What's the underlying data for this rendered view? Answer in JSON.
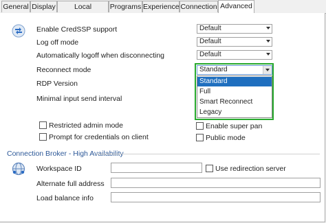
{
  "tabs": [
    {
      "label": "General",
      "active": false
    },
    {
      "label": "Display",
      "active": false
    },
    {
      "label": "Local Resources",
      "active": false
    },
    {
      "label": "Programs",
      "active": false
    },
    {
      "label": "Experience",
      "active": false
    },
    {
      "label": "Connection",
      "active": false
    },
    {
      "label": "Advanced",
      "active": true
    }
  ],
  "settings": {
    "credssp": {
      "label": "Enable CredSSP support",
      "value": "Default"
    },
    "logoff_mode": {
      "label": "Log off mode",
      "value": "Default"
    },
    "auto_logoff": {
      "label": "Automatically logoff when disconnecting",
      "value": "Default"
    },
    "reconnect": {
      "label": "Reconnect mode",
      "value": "Standard"
    },
    "rdp_version": {
      "label": "RDP Version"
    },
    "min_input": {
      "label": "Minimal input send interval"
    }
  },
  "reconnect_dropdown": {
    "options": [
      "Standard",
      "Full",
      "Smart Reconnect",
      "Legacy"
    ],
    "selected": "Standard"
  },
  "checkboxes": {
    "restricted_admin": {
      "label": "Restricted admin mode",
      "checked": false
    },
    "prompt_credentials": {
      "label": "Prompt for credentials on client",
      "checked": false
    },
    "super_pan": {
      "label": "Enable super pan",
      "checked": false
    },
    "public_mode": {
      "label": "Public mode",
      "checked": false
    }
  },
  "broker": {
    "section_title": "Connection Broker - High Availability",
    "workspace_id": {
      "label": "Workspace ID",
      "value": ""
    },
    "use_redirection": {
      "label": "Use redirection server",
      "checked": false
    },
    "alternate_address": {
      "label": "Alternate full address",
      "value": ""
    },
    "load_balance": {
      "label": "Load balance info",
      "value": ""
    }
  },
  "colors": {
    "accent": "#1f6fbf",
    "highlight_border": "#27a92c",
    "section_title": "#2b5797"
  },
  "icons": {
    "advanced": "remote-desktop-arrows-icon",
    "broker": "network-globe-icon"
  }
}
